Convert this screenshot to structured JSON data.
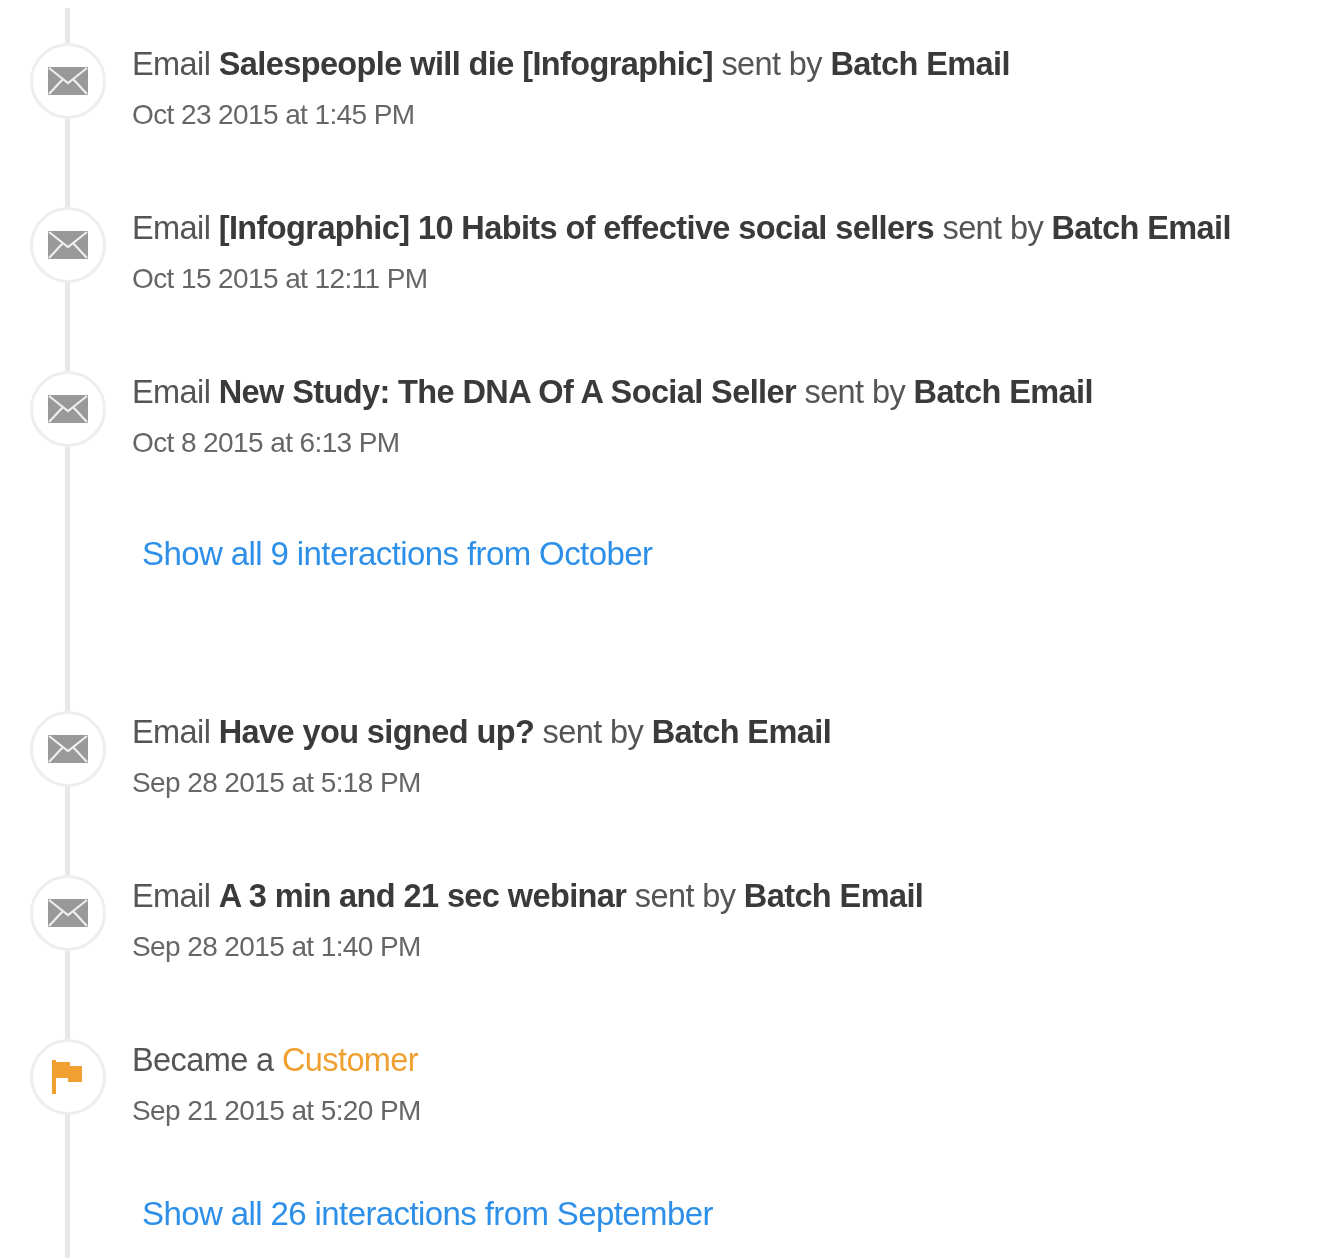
{
  "timeline": [
    {
      "kind": "email",
      "title": "Email **Salespeople will die [Infographic]** sent by **Batch Email**",
      "date": "Oct 23 2015 at 1:45 PM"
    },
    {
      "kind": "email",
      "title": "Email **[Infographic] 10 Habits of effective social sellers** sent by **Batch Email**",
      "date": "Oct 15 2015 at 12:11 PM"
    },
    {
      "kind": "email",
      "title": "Email **New Study: The DNA Of A Social Seller** sent by **Batch Email**",
      "date": "Oct 8 2015 at 6:13 PM"
    },
    {
      "kind": "link",
      "text": "Show all 9 interactions from October"
    },
    {
      "kind": "email",
      "title": "Email **Have you signed up?** sent by **Batch Email**",
      "date": "Sep 28 2015 at 5:18 PM"
    },
    {
      "kind": "email",
      "title": "Email **A 3 min and 21 sec webinar** sent by **Batch Email**",
      "date": "Sep 28 2015 at 1:40 PM"
    },
    {
      "kind": "milestone",
      "title": "Became a",
      "stage": "Customer",
      "date": "Sep 21 2015 at 5:20 PM"
    },
    {
      "kind": "link",
      "text": "Show all 26 interactions from September"
    }
  ]
}
